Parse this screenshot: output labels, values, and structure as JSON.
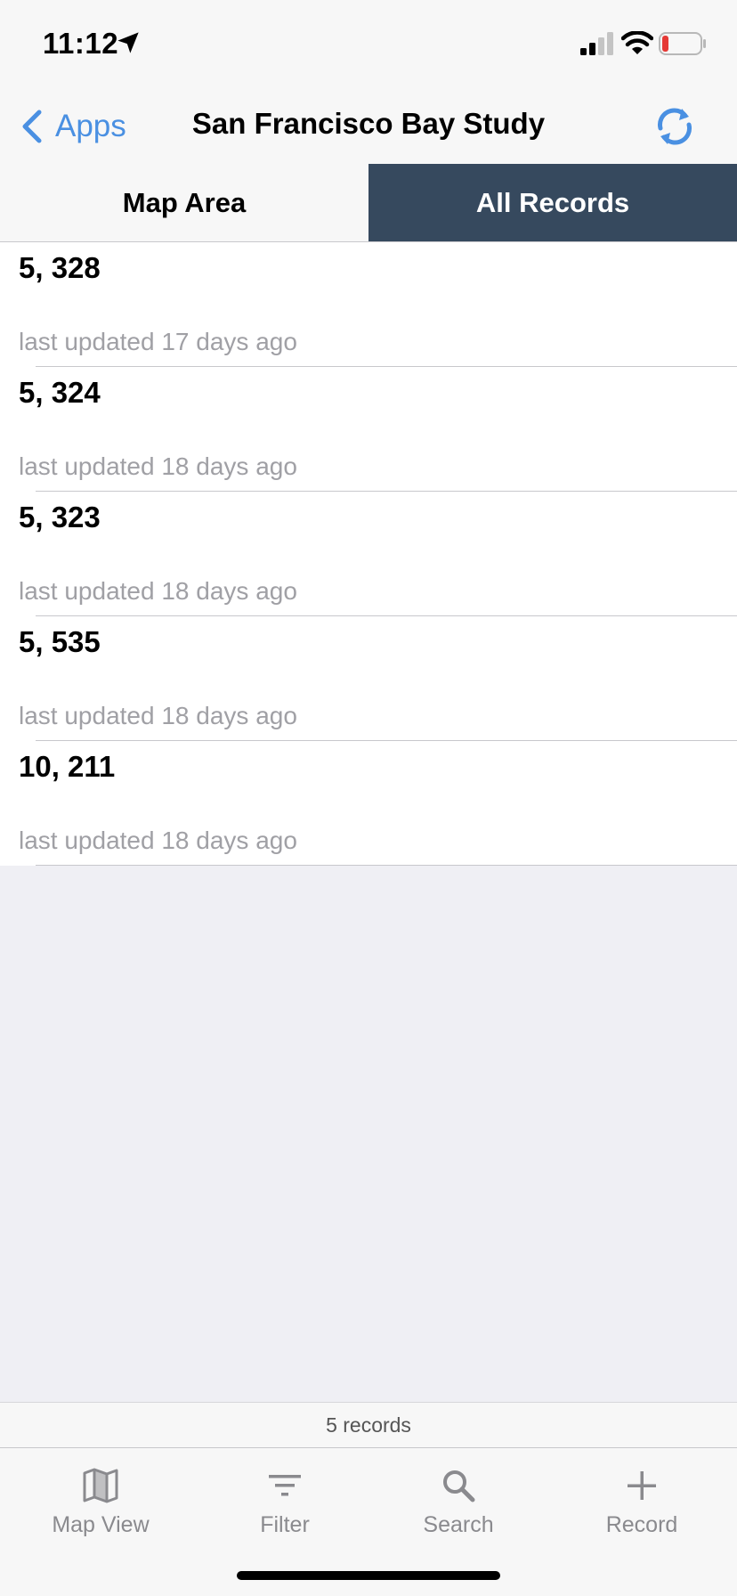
{
  "status_bar": {
    "time": "11:12"
  },
  "nav": {
    "back_label": "Apps",
    "title": "San Francisco Bay Study",
    "accent_color": "#4a90e2"
  },
  "tabs": [
    {
      "label": "Map Area",
      "active": false
    },
    {
      "label": "All Records",
      "active": true
    }
  ],
  "records": [
    {
      "title": "5, 328",
      "subtitle": "last updated 17 days ago"
    },
    {
      "title": "5, 324",
      "subtitle": "last updated 18 days ago"
    },
    {
      "title": "5, 323",
      "subtitle": "last updated 18 days ago"
    },
    {
      "title": "5, 535",
      "subtitle": "last updated 18 days ago"
    },
    {
      "title": "10, 211",
      "subtitle": "last updated 18 days ago"
    }
  ],
  "record_count": "5 records",
  "tabbar": [
    {
      "label": "Map View",
      "icon": "map-icon"
    },
    {
      "label": "Filter",
      "icon": "filter-icon"
    },
    {
      "label": "Search",
      "icon": "search-icon"
    },
    {
      "label": "Record",
      "icon": "plus-icon"
    }
  ],
  "colors": {
    "active_tab_bg": "#36495e",
    "battery_low": "#e53935"
  }
}
